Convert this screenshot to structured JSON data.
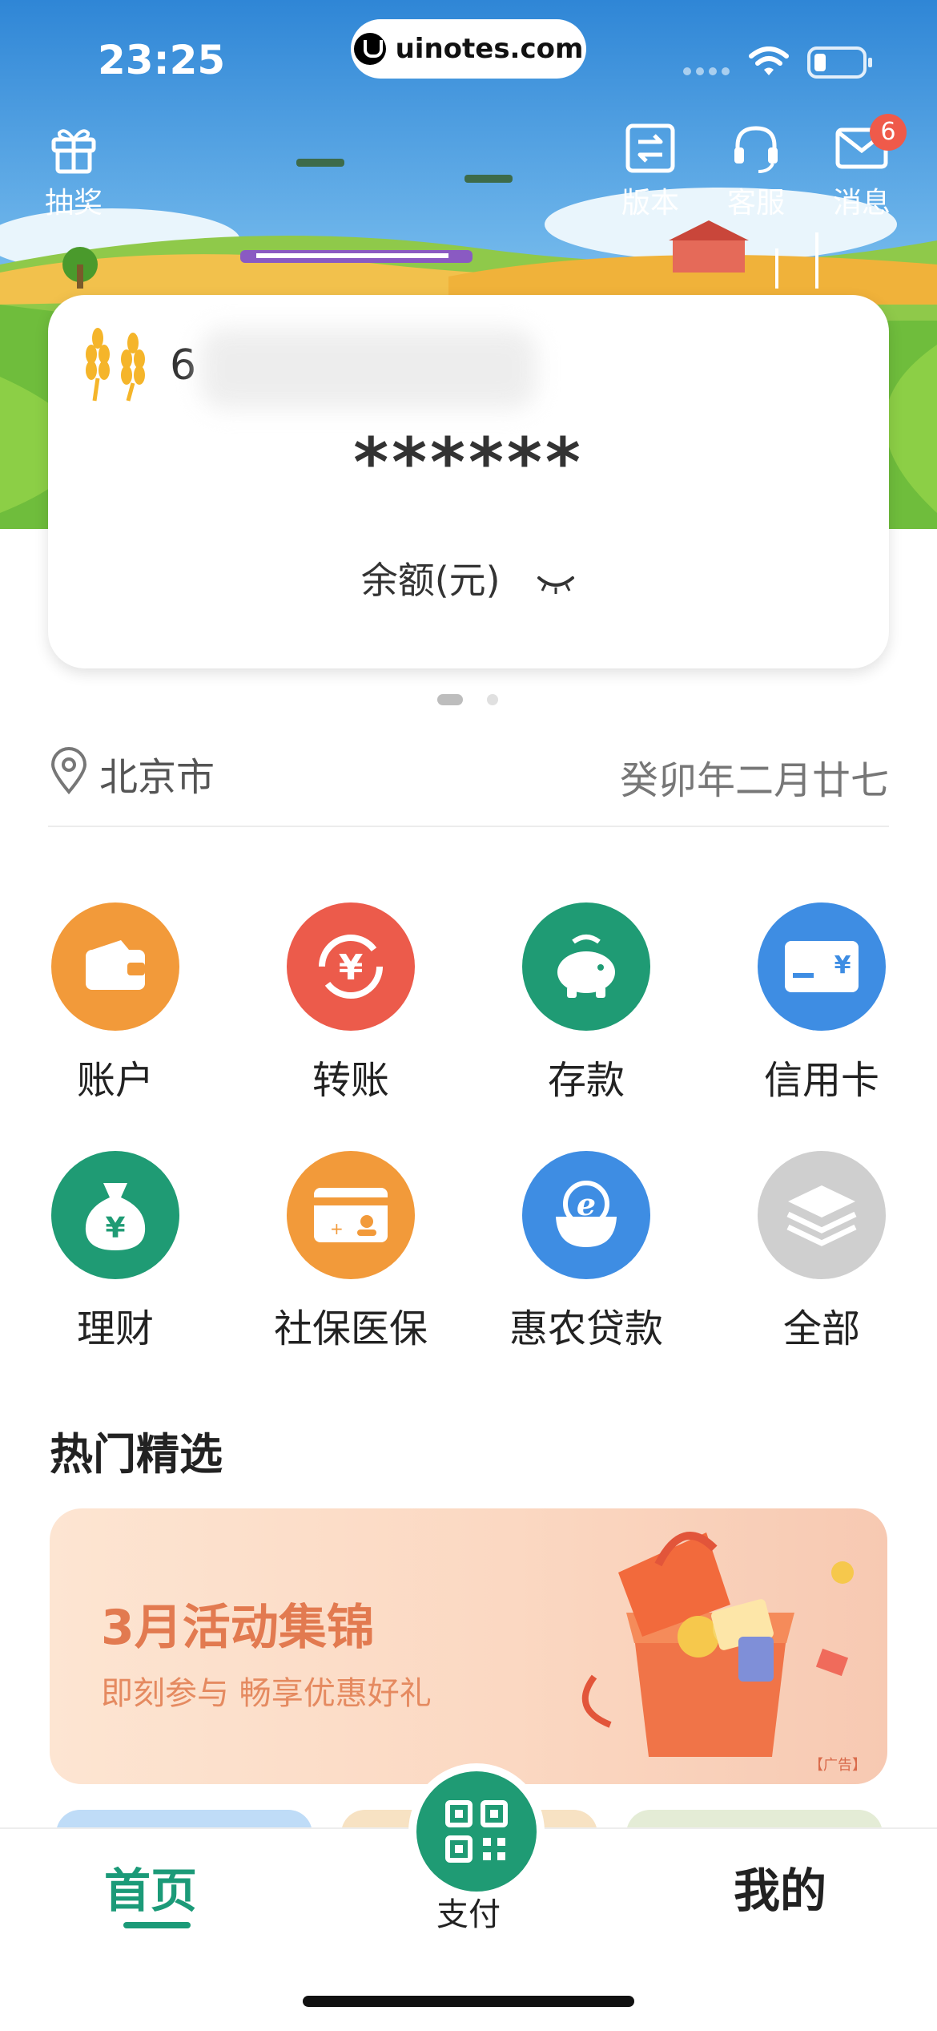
{
  "status_bar": {
    "time": "23:25",
    "url": "uinotes.com"
  },
  "header": {
    "left_button": {
      "label": "抽奖",
      "icon": "gift-icon"
    },
    "right_buttons": [
      {
        "label": "版本",
        "icon": "switch-version-icon"
      },
      {
        "label": "客服",
        "icon": "headset-icon"
      },
      {
        "label": "消息",
        "icon": "mail-icon",
        "badge": "6"
      }
    ]
  },
  "card": {
    "account_prefix": "6",
    "masked_balance": "******",
    "balance_label": "余额(元)"
  },
  "location": {
    "city": "北京市",
    "lunar_date": "癸卯年二月廿七"
  },
  "grid": [
    {
      "label": "账户",
      "icon": "wallet-icon",
      "color": "#f29a3a"
    },
    {
      "label": "转账",
      "icon": "transfer-yuan-icon",
      "color": "#ec5b4b"
    },
    {
      "label": "存款",
      "icon": "piggy-bank-icon",
      "color": "#1f9b74"
    },
    {
      "label": "信用卡",
      "icon": "credit-card-icon",
      "color": "#3e8de3"
    },
    {
      "label": "理财",
      "icon": "money-bag-icon",
      "color": "#1f9b74"
    },
    {
      "label": "社保医保",
      "icon": "social-insurance-card-icon",
      "color": "#f29a3a"
    },
    {
      "label": "惠农贷款",
      "icon": "loan-e-icon",
      "color": "#3e8de3"
    },
    {
      "label": "全部",
      "icon": "layers-icon",
      "color": "#cfcfcf"
    }
  ],
  "hot_section": {
    "title": "热门精选",
    "banner": {
      "title": "3月活动集锦",
      "subtitle": "即刻参与 畅享优惠好礼",
      "ad_tag": "【广告】"
    }
  },
  "tabbar": {
    "home": "首页",
    "pay": "支付",
    "mine": "我的"
  },
  "colors": {
    "brand_green": "#1b9a78",
    "badge_red": "#ef5a4a"
  }
}
